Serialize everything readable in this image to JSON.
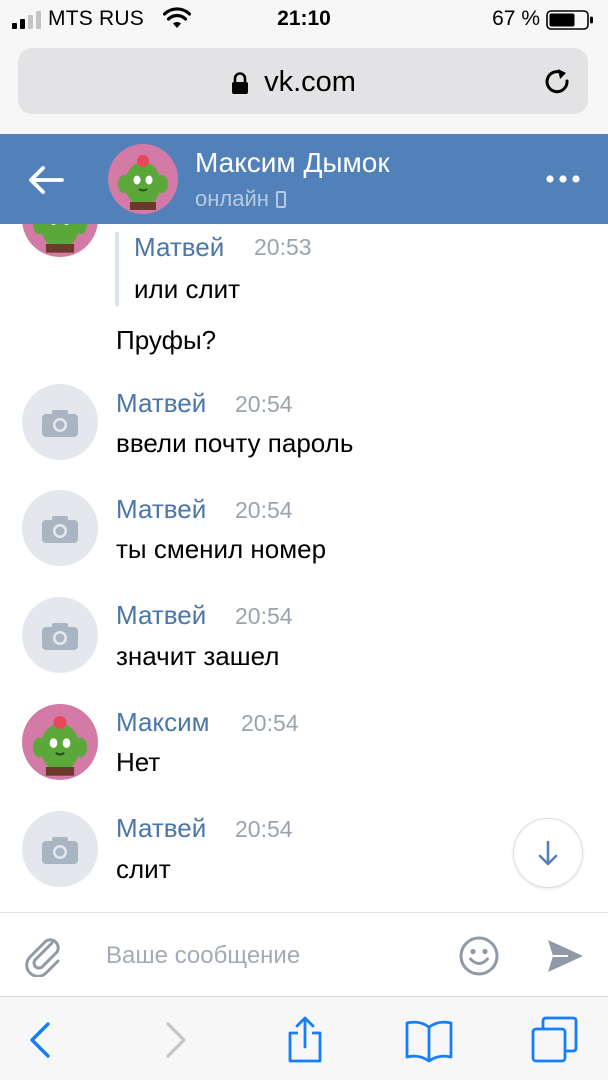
{
  "status_bar": {
    "carrier": "MTS RUS",
    "time": "21:10",
    "battery": "67 %"
  },
  "browser": {
    "url": "vk.com"
  },
  "header": {
    "name": "Максим Дымок",
    "status": "онлайн"
  },
  "messages": [
    {
      "type": "quote",
      "author": "Матвей",
      "time": "20:53",
      "text": "или слит",
      "reply": "Пруфы?"
    },
    {
      "author": "Матвей",
      "time": "20:54",
      "text": "ввели почту пароль",
      "avatar": "camera"
    },
    {
      "author": "Матвей",
      "time": "20:54",
      "text": "ты сменил номер",
      "avatar": "camera"
    },
    {
      "author": "Матвей",
      "time": "20:54",
      "text": "значит зашел",
      "avatar": "camera"
    },
    {
      "author": "Максим",
      "time": "20:54",
      "text": "Нет",
      "avatar": "cactus"
    },
    {
      "author": "Матвей",
      "time": "20:54",
      "text": "слит",
      "avatar": "camera"
    }
  ],
  "composer": {
    "placeholder": "Ваше сообщение"
  },
  "icons": {
    "back": "arrow-left-icon",
    "more": "ellipsis-icon",
    "attach": "paperclip-icon",
    "emoji": "smiley-icon",
    "send": "send-icon",
    "scroll": "chevron-down-icon"
  },
  "colors": {
    "vk_header": "#5181b8",
    "author_name": "#4a76a8",
    "timestamp": "#9aa4ae",
    "safari_blue": "#157efb"
  }
}
